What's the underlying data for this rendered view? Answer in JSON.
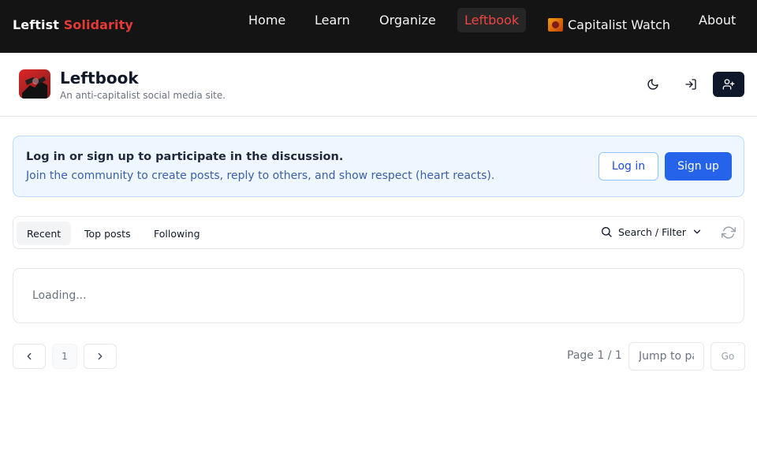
{
  "site": {
    "brand_main": "Leftist",
    "brand_accent": "Solidarity",
    "nav": [
      {
        "label": "Home"
      },
      {
        "label": "Learn"
      },
      {
        "label": "Organize"
      },
      {
        "label": "Leftbook",
        "active": true
      },
      {
        "label": "Capitalist Watch",
        "icon": "capitalist-watch-icon"
      },
      {
        "label": "About"
      }
    ]
  },
  "app": {
    "title": "Leftbook",
    "subtitle": "An anti-capitalist social media site.",
    "icons": [
      "moon-icon",
      "log-in-icon",
      "user-plus-icon"
    ]
  },
  "banner": {
    "title": "Log in or sign up to participate in the discussion.",
    "text": "Join the community to create posts, reply to others, and show respect (heart reacts).",
    "login_label": "Log in",
    "signup_label": "Sign up"
  },
  "feed": {
    "tabs": [
      {
        "label": "Recent",
        "active": true
      },
      {
        "label": "Top posts"
      },
      {
        "label": "Following"
      }
    ],
    "search_filter_label": "Search / Filter",
    "loading_text": "Loading..."
  },
  "pagination": {
    "current_page": "1",
    "page_info": "Page 1 / 1",
    "jump_placeholder": "Jump to page",
    "go_label": "Go"
  },
  "colors": {
    "nav_bg": "#141414",
    "accent_red": "#e53935",
    "primary_blue": "#2563eb",
    "banner_bg": "#eef6ff",
    "dark_button": "#0f172a"
  }
}
